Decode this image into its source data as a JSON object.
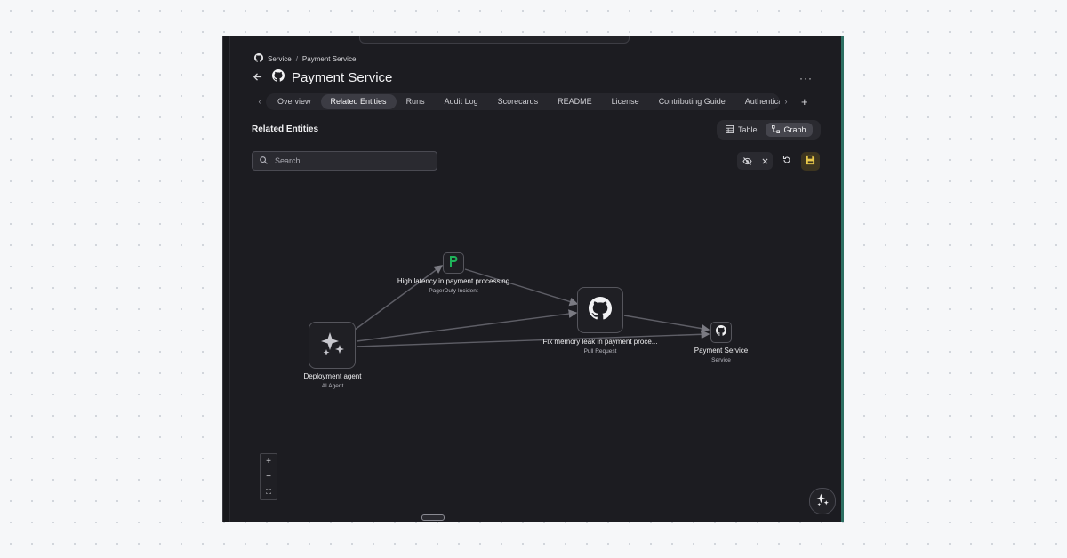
{
  "breadcrumb": {
    "parent": "Service",
    "separator": "/",
    "current": "Payment Service"
  },
  "header": {
    "title": "Payment Service",
    "more": "···"
  },
  "tabs": [
    {
      "label": "Overview"
    },
    {
      "label": "Related Entities"
    },
    {
      "label": "Runs"
    },
    {
      "label": "Audit Log"
    },
    {
      "label": "Scorecards"
    },
    {
      "label": "README"
    },
    {
      "label": "License"
    },
    {
      "label": "Contributing Guide"
    },
    {
      "label": "Authentica"
    }
  ],
  "section": {
    "title": "Related Entities"
  },
  "view_toggle": {
    "table": "Table",
    "graph": "Graph",
    "selected": "Graph"
  },
  "search": {
    "placeholder": "Search",
    "value": ""
  },
  "graph": {
    "nodes": {
      "agent": {
        "label": "Deployment agent",
        "type": "AI Agent",
        "icon": "sparkles-icon"
      },
      "incident": {
        "label": "High latency in payment processing",
        "type": "PagerDuty Incident",
        "icon": "pagerduty-icon"
      },
      "pr": {
        "label": "Fix memory leak in payment proce...",
        "type": "Pull Request",
        "icon": "github-icon"
      },
      "service": {
        "label": "Payment Service",
        "type": "Service",
        "icon": "github-icon"
      }
    }
  },
  "zoom": {
    "in": "+",
    "out": "−",
    "fit": "⛶"
  },
  "colors": {
    "background": "#1c1c21",
    "pagerduty": "#1fb35a",
    "save_accent": "#e8c84a",
    "edge": "#6a6a72"
  }
}
